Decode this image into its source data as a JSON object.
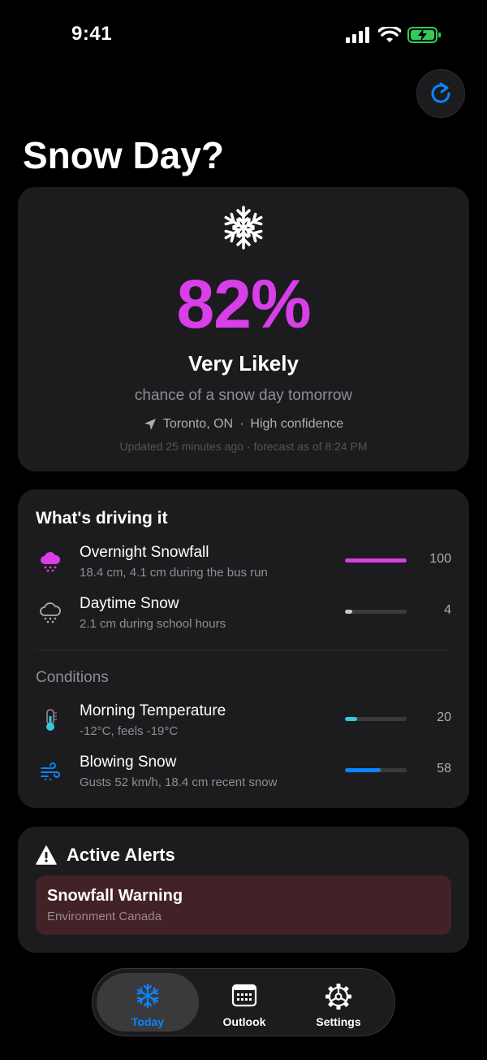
{
  "status_bar": {
    "time": "9:41"
  },
  "header": {
    "title": "Snow Day?",
    "refresh_icon": "refresh-icon"
  },
  "hero": {
    "icon": "snowflake-icon",
    "percent": "82%",
    "likelihood": "Very Likely",
    "subtitle": "chance of a snow day tomorrow",
    "location": "Toronto, ON",
    "separator": "·",
    "confidence": "High confidence",
    "updated": "Updated 25 minutes ago · forecast as of 8:24 PM"
  },
  "drivers": {
    "title": "What's driving it",
    "conditions_title": "Conditions",
    "factors": [
      {
        "icon": "snow-cloud-icon",
        "name": "Overnight Snowfall",
        "desc": "18.4 cm, 4.1 cm during the bus run",
        "score": "100",
        "level": 1.0,
        "color": "#d83fe8"
      },
      {
        "icon": "snow-cloud-outline-icon",
        "name": "Daytime Snow",
        "desc": "2.1 cm during school hours",
        "score": "4",
        "level": 0.04,
        "color": "#c7c7cc"
      }
    ],
    "conditions": [
      {
        "icon": "thermometer-icon",
        "name": "Morning Temperature",
        "desc": "-12°C, feels -19°C",
        "score": "20",
        "level": 0.2,
        "color": "#35c8e0"
      },
      {
        "icon": "wind-icon",
        "name": "Blowing Snow",
        "desc": "Gusts 52 km/h, 18.4 cm recent snow",
        "score": "58",
        "level": 0.58,
        "color": "#0a84ff"
      }
    ]
  },
  "alerts": {
    "title": "Active Alerts",
    "items": [
      {
        "title": "Snowfall Warning",
        "source": "Environment Canada"
      }
    ]
  },
  "tabs": [
    {
      "label": "Today",
      "icon": "snowflake-icon",
      "active": true
    },
    {
      "label": "Outlook",
      "icon": "calendar-icon",
      "active": false
    },
    {
      "label": "Settings",
      "icon": "gear-icon",
      "active": false
    }
  ],
  "colors": {
    "accent": "#d83fe8",
    "tab_active": "#0a84ff",
    "alert_bg": "#422226"
  }
}
